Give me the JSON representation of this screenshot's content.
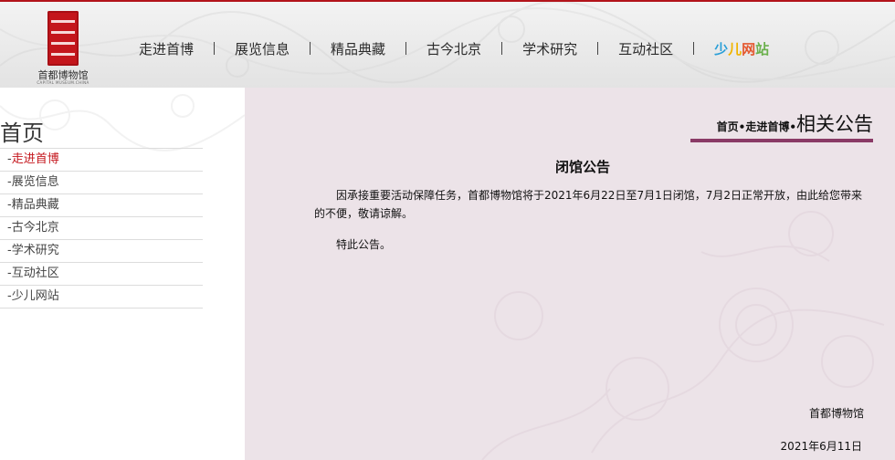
{
  "header": {
    "logo_text": "首都博物馆",
    "logo_subtext": "CAPITAL MUSEUM.CHINA",
    "nav": [
      {
        "label": "走进首博"
      },
      {
        "label": "展览信息"
      },
      {
        "label": "精品典藏"
      },
      {
        "label": "古今北京"
      },
      {
        "label": "学术研究"
      },
      {
        "label": "互动社区"
      }
    ],
    "kids": [
      "少",
      "儿",
      "网",
      "站"
    ],
    "colors": {
      "top_border": "#b3141b",
      "kids": [
        "#2a9fd8",
        "#f0b400",
        "#e4572e",
        "#6ab04c"
      ]
    }
  },
  "sidebar": {
    "title": "首页",
    "items": [
      {
        "label": "走进首博",
        "active": true
      },
      {
        "label": "展览信息"
      },
      {
        "label": "精品典藏"
      },
      {
        "label": "古今北京"
      },
      {
        "label": "学术研究"
      },
      {
        "label": "互动社区"
      },
      {
        "label": "少儿网站"
      }
    ],
    "dash": "-"
  },
  "main": {
    "breadcrumb": {
      "home": "首页",
      "sep": "•",
      "section": "走进首博",
      "current": "相关公告"
    },
    "title": "闭馆公告",
    "paragraphs": [
      "因承接重要活动保障任务，首都博物馆将于2021年6月22日至7月1日闭馆，7月2日正常开放，由此给您带来的不便，敬请谅解。",
      "特此公告。"
    ],
    "signer": "首都博物馆",
    "date": "2021年6月11日",
    "colors": {
      "background": "#ece3e8",
      "accent_bar": "#8a3a66"
    }
  }
}
